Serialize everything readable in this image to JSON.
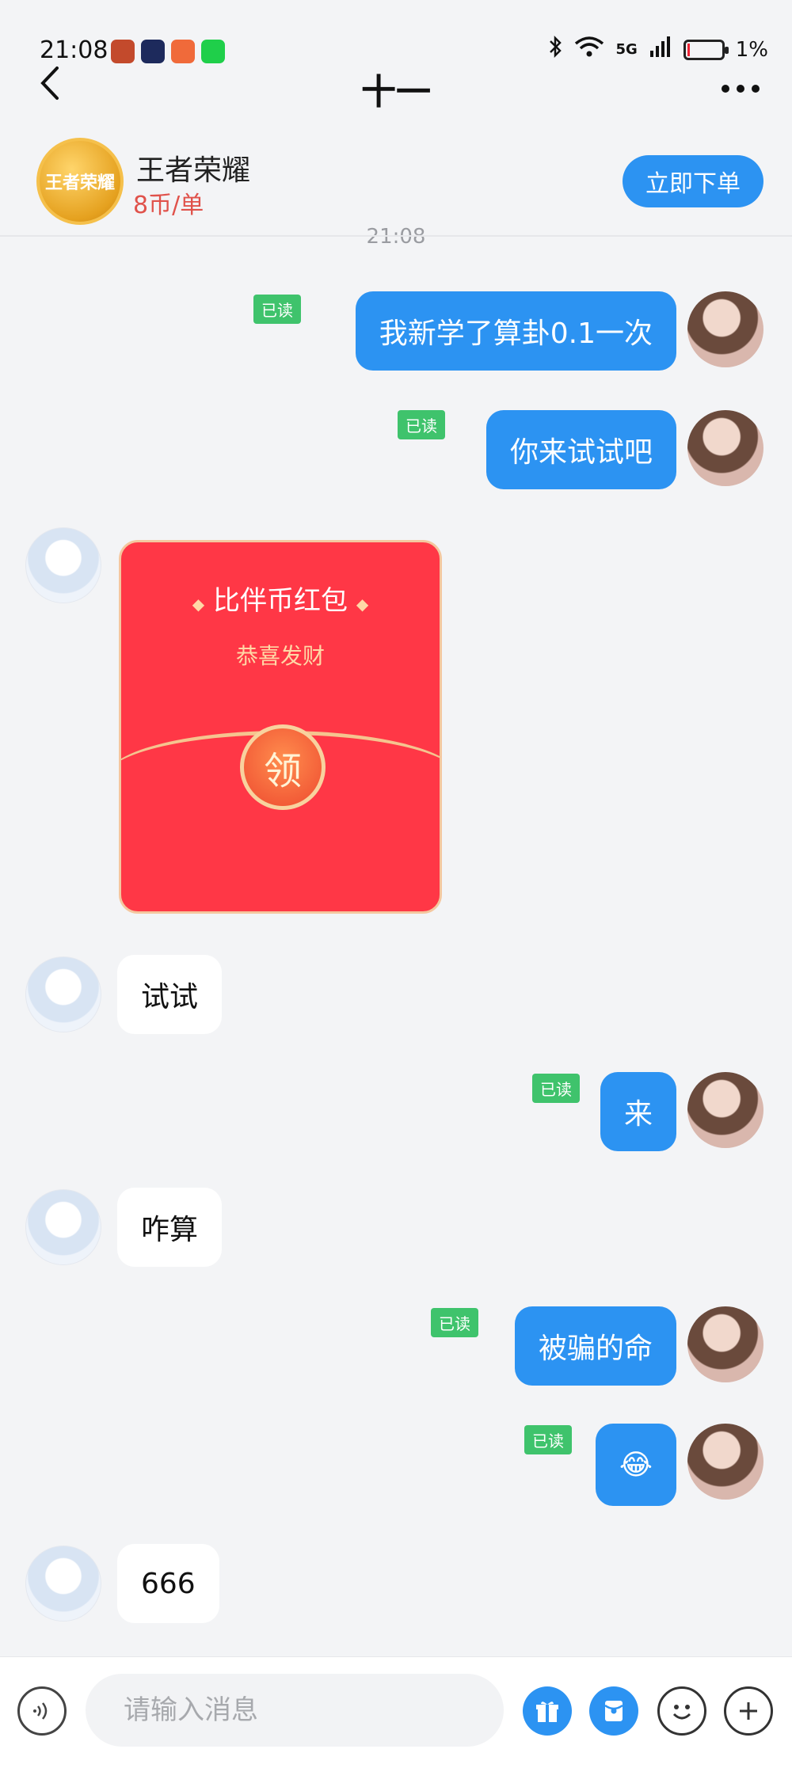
{
  "status_bar": {
    "time": "21:08",
    "network": "5G",
    "battery": "1%"
  },
  "header": {
    "title": "十一",
    "game_name": "王者荣耀",
    "game_logo_text": "王者荣耀",
    "price": "8币/单",
    "order_button": "立即下单",
    "timestamp": "21:08"
  },
  "messages": [
    {
      "sender": "me",
      "text": "我新学了算卦0.1一次",
      "read": "已读"
    },
    {
      "sender": "me",
      "text": "你来试试吧",
      "read": "已读"
    },
    {
      "sender": "other",
      "type": "red_packet",
      "title": "比伴币红包",
      "subtitle": "恭喜发财",
      "open_label": "领"
    },
    {
      "sender": "other",
      "text": "试试"
    },
    {
      "sender": "me",
      "text": "来",
      "read": "已读"
    },
    {
      "sender": "other",
      "text": "咋算"
    },
    {
      "sender": "me",
      "text": "被骗的命",
      "read": "已读"
    },
    {
      "sender": "me",
      "text": "😂",
      "read": "已读"
    },
    {
      "sender": "other",
      "text": "666"
    }
  ],
  "input": {
    "placeholder": "请输入消息"
  },
  "colors": {
    "accent": "#2c93f2",
    "read_badge": "#3fc36c",
    "red_packet": "#ff3746",
    "price": "#e0524b"
  }
}
